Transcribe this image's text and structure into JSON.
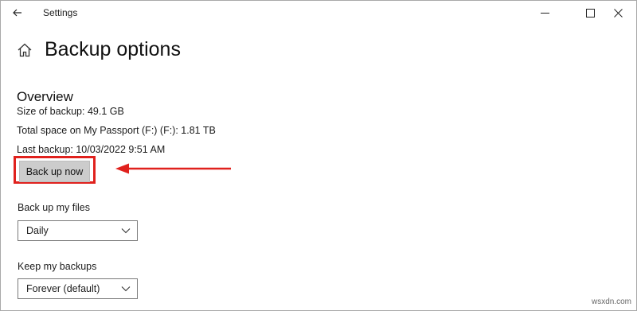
{
  "window": {
    "title": "Settings"
  },
  "page": {
    "title": "Backup options"
  },
  "overview": {
    "heading": "Overview",
    "size_of_backup": "Size of backup: 49.1 GB",
    "total_space": "Total space on My Passport (F:) (F:): 1.81 TB",
    "last_backup": "Last backup: 10/03/2022 9:51 AM",
    "backup_button_label": "Back up now"
  },
  "backup_files": {
    "label": "Back up my files",
    "selected": "Daily"
  },
  "keep_backups": {
    "label": "Keep my backups",
    "selected": "Forever (default)"
  },
  "annotation": {
    "color": "#e0211d"
  },
  "watermark": "wsxdn.com",
  "icons": {
    "back": "back-arrow-icon",
    "home": "home-icon",
    "minimize": "minimize-icon",
    "maximize": "maximize-icon",
    "close": "close-icon",
    "dropdown": "chevron-down-icon"
  }
}
